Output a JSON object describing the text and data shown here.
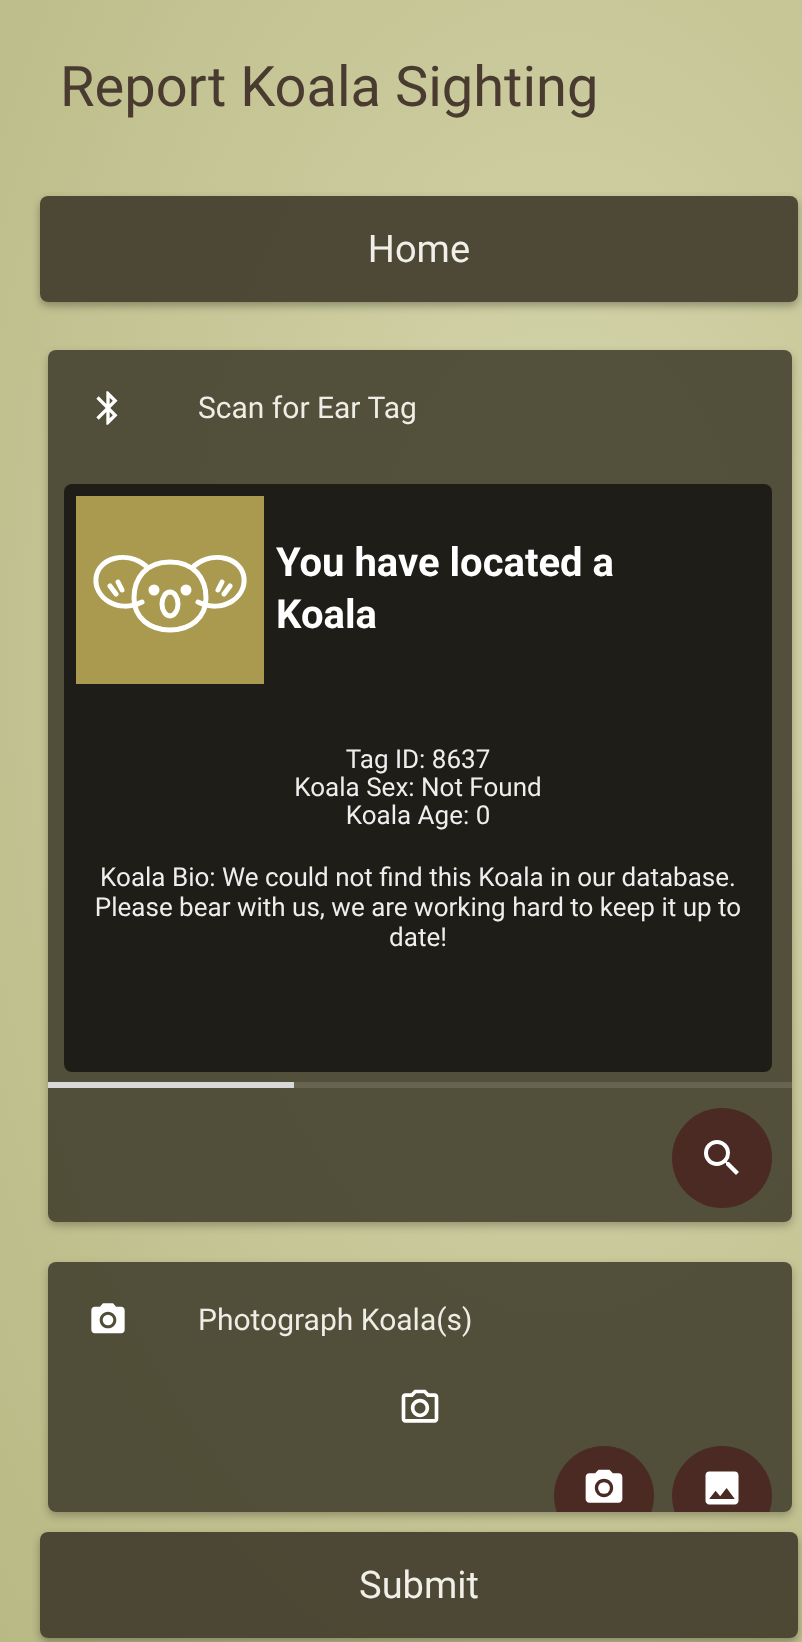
{
  "title": "Report Koala Sighting",
  "home_button": "Home",
  "scan_section": {
    "label": "Scan for Ear Tag",
    "result": {
      "heading": "You have located a Koala",
      "details": [
        "Tag ID: 8637",
        "Koala Sex: Not Found",
        "Koala Age: 0"
      ],
      "bio": "Koala Bio: We could not find this Koala in our database. Please bear with us, we are working hard to keep it up to date!"
    },
    "progress": {
      "level": 0.33
    }
  },
  "photo_section": {
    "label": "Photograph Koala(s)"
  },
  "submit_button": "Submit"
}
